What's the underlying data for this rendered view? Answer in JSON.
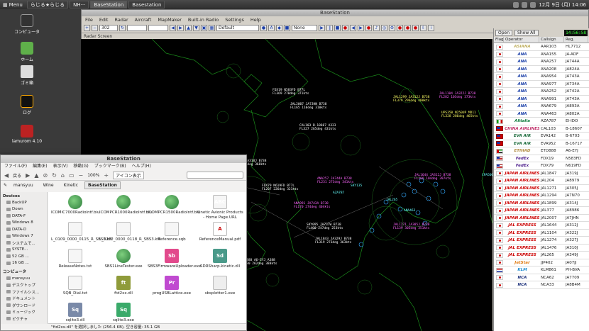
{
  "topbar": {
    "menu_label": "Menu",
    "tasks": [
      "らじる★らじる",
      "NH···",
      "BaseStation",
      "Basestation"
    ],
    "clock": "12月 9日 (月) 14:06"
  },
  "desktop": {
    "icons": [
      "コンピュータ",
      "ホーム",
      "ゴミ箱",
      "ログ",
      "lamurom 4.10"
    ]
  },
  "basestation": {
    "title": "BaseStation",
    "menu": [
      "File",
      "Edit",
      "Radar",
      "Aircraft",
      "MapMaker",
      "Built-in Radio",
      "Settings",
      "Help"
    ],
    "toolbar": {
      "zoom": "302",
      "layout": "Default",
      "filter": "None"
    },
    "radar_label": "Radar Screen",
    "panel": {
      "open_label": "Open",
      "show_all_label": "Show All",
      "clock": "14:56:58"
    },
    "list_headers": [
      "Flag",
      "Operator",
      "Callsign",
      "Reg."
    ],
    "rows": [
      {
        "flag": "kr",
        "op": "ASIANA",
        "cs": "AAR103",
        "reg": "HL7712",
        "color": "#c0b060"
      },
      {
        "flag": "jp",
        "op": "ANA",
        "cs": "ANA155",
        "reg": "JA-ADF",
        "color": "#1a3fa8"
      },
      {
        "flag": "jp",
        "op": "ANA",
        "cs": "ANA257",
        "reg": "JA744A",
        "color": "#1a3fa8"
      },
      {
        "flag": "jp",
        "op": "ANA",
        "cs": "ANA208",
        "reg": "JA824A",
        "color": "#1a3fa8"
      },
      {
        "flag": "jp",
        "op": "ANA",
        "cs": "ANA954",
        "reg": "JA743A",
        "color": "#1a3fa8"
      },
      {
        "flag": "jp",
        "op": "ANA",
        "cs": "ANA977",
        "reg": "JA734A",
        "color": "#1a3fa8"
      },
      {
        "flag": "jp",
        "op": "ANA",
        "cs": "ANA252",
        "reg": "JA742A",
        "color": "#1a3fa8"
      },
      {
        "flag": "jp",
        "op": "ANA",
        "cs": "ANA991",
        "reg": "JA743A",
        "color": "#1a3fa8"
      },
      {
        "flag": "jp",
        "op": "ANA",
        "cs": "ANA679",
        "reg": "JA893A",
        "color": "#1a3fa8"
      },
      {
        "flag": "jp",
        "op": "ANA",
        "cs": "ANA463",
        "reg": "JA802A",
        "color": "#1a3fa8"
      },
      {
        "flag": "it",
        "op": "Alitalia",
        "cs": "AZA787",
        "reg": "EI-IDO",
        "color": "#0a7a3a"
      },
      {
        "flag": "tw",
        "op": "CHINA AIRLINES",
        "cs": "CAL103",
        "reg": "B-18607",
        "color": "#c0306a"
      },
      {
        "flag": "tw",
        "op": "EVA AIR",
        "cs": "EVA142",
        "reg": "B-6703",
        "color": "#1a6a3a"
      },
      {
        "flag": "tw",
        "op": "EVA AIR",
        "cs": "EVA952",
        "reg": "B-16717",
        "color": "#1a6a3a"
      },
      {
        "flag": "ae",
        "op": "ETIHAD",
        "cs": "ETD888",
        "reg": "A6-EYJ",
        "color": "#b08a40"
      },
      {
        "flag": "us",
        "op": "FedEx",
        "cs": "FDX19",
        "reg": "N583FD",
        "color": "#4a1a8a"
      },
      {
        "flag": "us",
        "op": "FedEx",
        "cs": "FDX79",
        "reg": "N619FD",
        "color": "#4a1a8a"
      },
      {
        "flag": "jp",
        "op": "JAPAN AIRLINES",
        "cs": "JAL1847",
        "reg": "JA319J",
        "color": "#c00"
      },
      {
        "flag": "jp",
        "op": "JAPAN AIRLINES",
        "cs": "JAL204",
        "reg": "JA8979",
        "color": "#c00"
      },
      {
        "flag": "jp",
        "op": "JAPAN AIRLINES",
        "cs": "JAL1271",
        "reg": "JA305J",
        "color": "#c00"
      },
      {
        "flag": "jp",
        "op": "JAPAN AIRLINES",
        "cs": "JAL1294",
        "reg": "JA7N70",
        "color": "#c00"
      },
      {
        "flag": "jp",
        "op": "JAPAN AIRLINES",
        "cs": "JAL1899",
        "reg": "JA314J",
        "color": "#c00"
      },
      {
        "flag": "jp",
        "op": "JAPAN AIRLINES",
        "cs": "JAL377",
        "reg": "JA8986",
        "color": "#c00"
      },
      {
        "flag": "jp",
        "op": "JAPAN AIRLINES",
        "cs": "JAL2007",
        "reg": "JA7JHN",
        "color": "#c00"
      },
      {
        "flag": "jp",
        "op": "JAL EXPRESS",
        "cs": "JAL1644",
        "reg": "JA312J",
        "color": "#c00"
      },
      {
        "flag": "jp",
        "op": "JAL EXPRESS",
        "cs": "JAL1104",
        "reg": "JA322J",
        "color": "#c00"
      },
      {
        "flag": "jp",
        "op": "JAL EXPRESS",
        "cs": "JAL1274",
        "reg": "JA327J",
        "color": "#c00"
      },
      {
        "flag": "jp",
        "op": "JAL EXPRESS",
        "cs": "JAL1476",
        "reg": "JA310J",
        "color": "#c00"
      },
      {
        "flag": "jp",
        "op": "JAL EXPRESS",
        "cs": "JAL265",
        "reg": "JA349J",
        "color": "#c00"
      },
      {
        "flag": "jp",
        "op": "JetStar",
        "cs": "JJP402",
        "reg": "JA07JJ",
        "color": "#e07a10"
      },
      {
        "flag": "nl",
        "op": "KLM",
        "cs": "KLM861",
        "reg": "PH-BVA",
        "color": "#1a8ad0"
      },
      {
        "flag": "jp",
        "op": "NCA",
        "cs": "NCA62",
        "reg": "JA7709",
        "color": "#1a2f7a"
      },
      {
        "flag": "jp",
        "op": "NCA",
        "cs": "NCA33",
        "reg": "JA8B4M",
        "color": "#1a2f7a"
      }
    ],
    "aircraft": [
      {
        "text": "FDX19 N583FD B77L\nFL369 270deg 371kts",
        "color": "#ffffff"
      },
      {
        "text": "JAL2007 JA7JHN B738\nFL165 110deg 310kts",
        "color": "#ffffff"
      },
      {
        "text": "CAL103 B-18607 A333\nFL327 265deg 431kts",
        "color": "#ffffff"
      },
      {
        "text": "JAL1299 JA312J B738\nFL379 296deg 400kts",
        "color": "#ffff66"
      },
      {
        "text": "JAL1104 JA322J B738\nFL282 103deg 373kts",
        "color": "#ff66ff"
      },
      {
        "text": "UPS350 N250UP MD11\nFL328 286deg 465kts",
        "color": "#ffff66"
      },
      {
        "text": "JAL1476 JA310J B738\nFL357 262deg 368kts",
        "color": "#ffffff"
      },
      {
        "text": "FDX79 N619FD B77L\nFL207 226deg 321kts",
        "color": "#ffffff"
      },
      {
        "text": "ANA257 JA744A B738\nFL231 273deg 341kts",
        "color": "#ff66ff"
      },
      {
        "text": "JAL1644 JA312J B738\nFL300 104deg 397kts",
        "color": "#ff66ff"
      },
      {
        "text": "ANA991 JA743A B738\nFL170 274deg 404kts",
        "color": "#ff66ff"
      },
      {
        "text": "SKY095 JA737W B738\nFL400 247deg 253kts",
        "color": "#ffffff"
      },
      {
        "text": "JAL1843 JA329J B738\nFL319 273deg 363kts",
        "color": "#ffffff"
      },
      {
        "text": "ETD888 A6-EYJ A388\nFL390 262deg 388kts",
        "color": "#ffffff"
      },
      {
        "text": "JAL1271 JA305J B738\nFL139 303deg 351kts",
        "color": "#ff66ff"
      },
      {
        "text": "KLM861 PH-BVA B77W\nFL310 270deg 440kts",
        "color": "#ffffff"
      }
    ],
    "cyan_tags": [
      "CPA506",
      "SKY135",
      "ANA463",
      "AZA787",
      "JAL265"
    ]
  },
  "filemanager": {
    "title": "BaseStation",
    "menu": [
      "ファイル(F)",
      "編集(E)",
      "表示(V)",
      "移動(G)",
      "ブックマーク(B)",
      "ヘルプ(H)"
    ],
    "toolbar": {
      "back": "戻る",
      "zoom": "100%",
      "view": "アイコン表示"
    },
    "path": [
      "mansyuu",
      "Wine",
      "Kinetic",
      "BaseStation"
    ],
    "sidebar_sections": [
      {
        "title": "Devices",
        "items": [
          "BackUP",
          "Down",
          "DATA-F",
          "Windows 8",
          "DATA-D",
          "Windows 7",
          "システムで...",
          "SYSTE...",
          "52 GB ...",
          "16 GB ..."
        ]
      },
      {
        "title": "コンピュータ",
        "items": [
          "mansyuu",
          "デスクトップ",
          "ファイルシス...",
          "ドキュメント",
          "ダウンロード",
          "ミュージック",
          "ピクチャ"
        ]
      }
    ],
    "files": [
      {
        "name": "ICOMIC7000RadioIntf.biu",
        "icon": "globe"
      },
      {
        "name": "ICOMPCR1000RadioIntf.biu",
        "icon": "globe"
      },
      {
        "name": "ICOMPCR1500RadioIntf.biu",
        "icon": "globe"
      },
      {
        "name": "Kinetic Avionic Products - Home Page.URL",
        "icon": "doc",
        "glyph": "ABC"
      },
      {
        "name": "L_0109_0000_0115_R_SBS3.kff",
        "icon": "doc"
      },
      {
        "name": "L_0202_0000_0118_R_SBS3.kff",
        "icon": "doc"
      },
      {
        "name": "Reference.sqb",
        "icon": "doc"
      },
      {
        "name": "ReferenceManual.pdf",
        "icon": "pdf",
        "glyph": "A"
      },
      {
        "name": "ReleaseNotes.txt",
        "icon": "doc"
      },
      {
        "name": "SBS1LineTester.exe",
        "icon": "globe"
      },
      {
        "name": "SBS3FirmwareUploader.exe",
        "icon": "sb",
        "glyph": "Sb"
      },
      {
        "name": "SDRSharp.kinetic.dll",
        "icon": "sd",
        "glyph": "Sd"
      },
      {
        "name": "SQB_Dial.txt",
        "icon": "doc"
      },
      {
        "name": "ftd2xx.dll",
        "icon": "dll",
        "glyph": "ft"
      },
      {
        "name": "progUSBLattice.exe",
        "icon": "pr",
        "glyph": "Pr"
      },
      {
        "name": "sbsplotter1.exe",
        "icon": "exe"
      },
      {
        "name": "sqlite3.dll",
        "icon": "sq",
        "glyph": "Sq"
      },
      {
        "name": "sqlite3.exe",
        "icon": "sq2",
        "glyph": "Sq"
      }
    ],
    "status": "\"ftd2xx.dll\" を選択しました (256.4 KB), 空き容量: 35.1 GB"
  }
}
